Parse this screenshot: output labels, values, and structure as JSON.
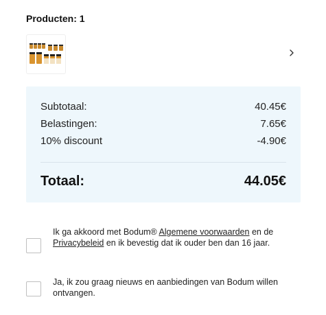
{
  "products": {
    "heading": "Producten: 1",
    "thumbnail_icon": "product-thumbnail-image",
    "chevron_icon": "chevron-right-icon"
  },
  "summary": {
    "subtotal_label": "Subtotaal:",
    "subtotal_value": "40.45€",
    "tax_label": "Belastingen:",
    "tax_value": "7.65€",
    "discount_label": "10% discount",
    "discount_value": "-4.90€",
    "total_label": "Totaal:",
    "total_value": "44.05€",
    "background_color": "#eef7fc"
  },
  "consent": {
    "terms_prefix": "Ik ga akkoord met Bodum® ",
    "terms_link": "Algemene voorwaarden",
    "terms_middle": " en de ",
    "privacy_link": "Privacybeleid",
    "terms_suffix": " en ik bevestig dat ik ouder ben dan 16 jaar.",
    "terms_checked": false,
    "newsletter_text": "Ja, ik zou graag nieuws en aanbiedingen van Bodum willen ontvangen.",
    "newsletter_checked": false
  }
}
